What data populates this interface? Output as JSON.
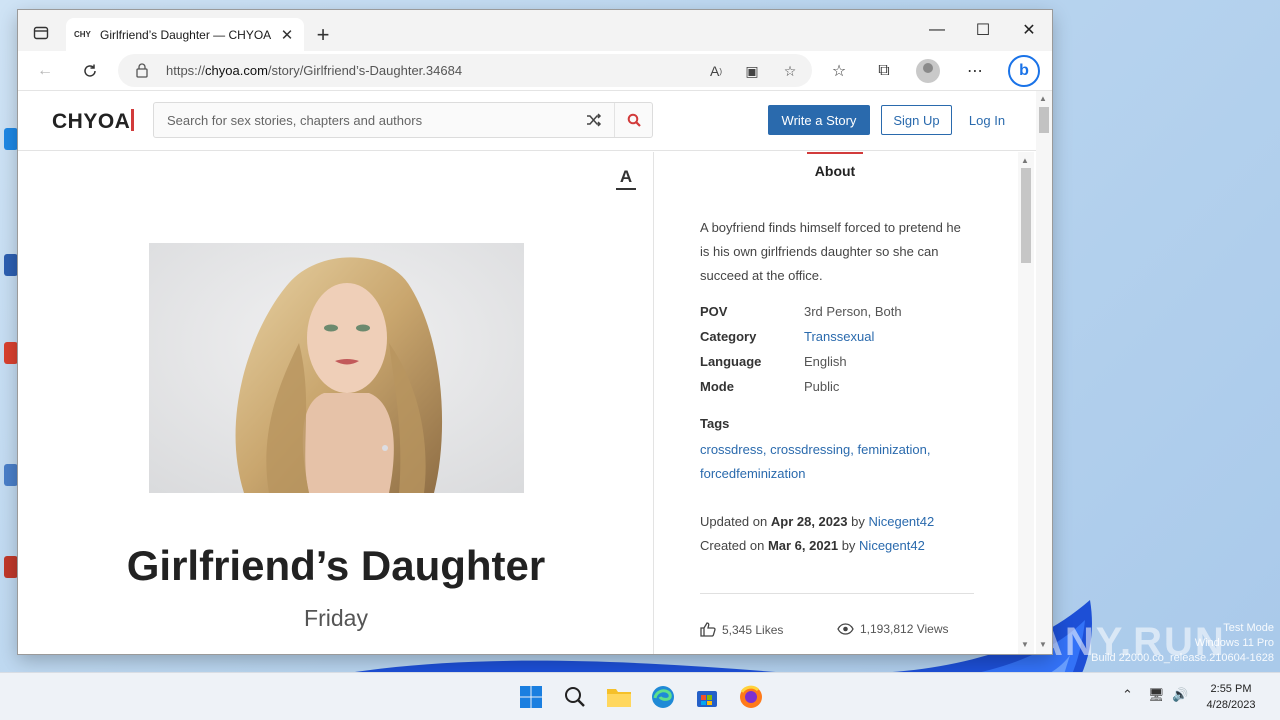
{
  "browser": {
    "tab_title": "Girlfriend’s Daughter — CHYOA",
    "tab_favicon": "CHY",
    "tab_close": "✕",
    "new_tab": "+",
    "url_prefix": "https://",
    "url_domain": "chyoa.com",
    "url_path": "/story/Girlfriend’s-Daughter.34684"
  },
  "site": {
    "logo": "CHYOA",
    "search_placeholder": "Search for sex stories, chapters and authors",
    "write_story": "Write a Story",
    "sign_up": "Sign Up",
    "log_in": "Log In"
  },
  "story": {
    "title": "Girlfriend’s Daughter",
    "chapter": "Friday",
    "font_toggle": "A"
  },
  "about": {
    "tab_label": "About",
    "summary": "A boyfriend finds himself forced to pretend he is his own girlfriends daughter so she can succeed at the office.",
    "meta": [
      {
        "key": "POV",
        "value": "3rd Person, Both"
      },
      {
        "key": "Category",
        "value": "Transsexual"
      },
      {
        "key": "Language",
        "value": "English"
      },
      {
        "key": "Mode",
        "value": "Public"
      }
    ],
    "tags_heading": "Tags",
    "tags": "crossdress, crossdressing, feminization, forcedfeminization",
    "updated_prefix": "Updated on",
    "updated_date": "Apr 28, 2023",
    "updated_by": "by",
    "updated_author": "Nicegent42",
    "created_prefix": "Created on",
    "created_date": "Mar 6, 2021",
    "created_by": "by",
    "created_author": "Nicegent42",
    "likes": "5,345 Likes",
    "views": "1,193,812 Views"
  },
  "watermark": {
    "logo": "ANY.RUN",
    "line1": "Test Mode",
    "line2": "Windows 11 Pro",
    "line3": "Build 22000.co_release.210604-1628"
  },
  "taskbar": {
    "time": "2:55 PM",
    "date": "4/28/2023"
  },
  "colors": {
    "accent": "#2a6aad",
    "logo_cursor": "#d23b3b"
  }
}
